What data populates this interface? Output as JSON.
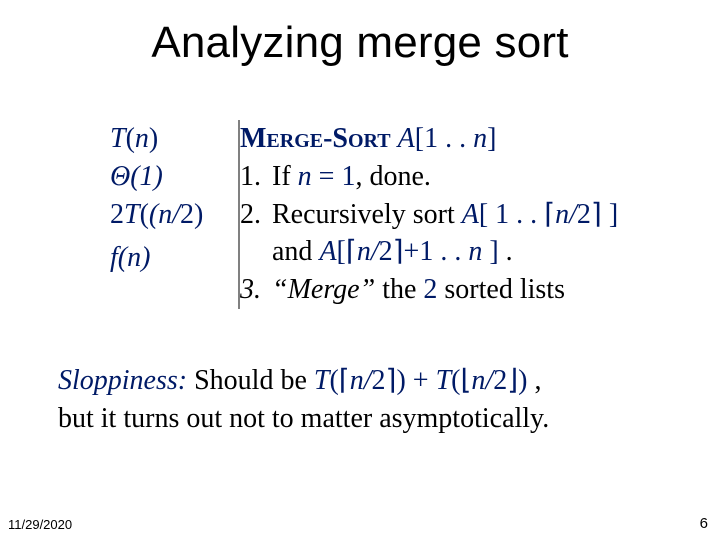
{
  "title": "Analyzing merge sort",
  "left": {
    "l1_pre": "T",
    "l1_arg": "(n)",
    "l2": "Θ(1)",
    "l3_pre": "2",
    "l3_T": "T",
    "l3_arg": "(n/",
    "l3_end": "2)",
    "l4": "f(n)"
  },
  "right": {
    "header_sc": "Merge-Sort ",
    "header_A": "A",
    "header_rng": "[1 . . ",
    "header_n": "n",
    "header_end": "]",
    "s1_a": "If ",
    "s1_n": "n",
    "s1_b": " = 1",
    "s1_c": ", done.",
    "s2_a": "Recursively sort ",
    "s2_A1": "A",
    "s2_b": "[ 1 . . ⌈",
    "s2_n1": "n/",
    "s2_c": "2⌉ ]",
    "s2_and": "and ",
    "s2_A2": "A",
    "s2_d": "[⌈",
    "s2_n2": "n/",
    "s2_e": "2⌉+1 . . ",
    "s2_n3": "n",
    "s2_f": " ] .",
    "s3_a": "“Merge”",
    "s3_b": " the ",
    "s3_two": "2",
    "s3_c": " sorted lists"
  },
  "slop": {
    "label": "Sloppiness:",
    "a": " Should be ",
    "T1": "T",
    "b": "(⌈",
    "n1": "n/",
    "c": "2⌉) + ",
    "T2": "T",
    "d": "(⌊",
    "n2": "n/",
    "e": "2⌋) ,",
    "line2": "but it turns out not to matter asymptotically."
  },
  "footer": {
    "date": "11/29/2020",
    "page": "6"
  }
}
